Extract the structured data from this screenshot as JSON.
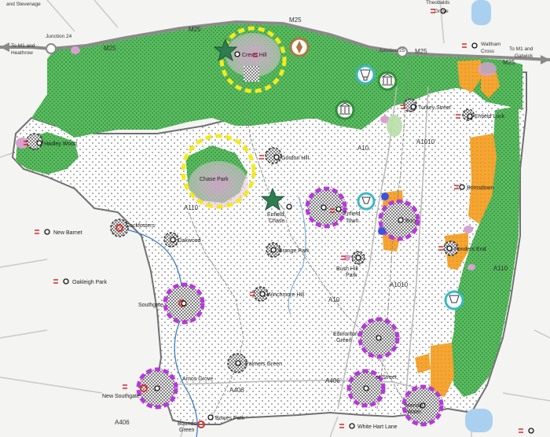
{
  "roads": {
    "m25": "M25",
    "a10": "A10",
    "a1010": "A1010",
    "a406": "A406",
    "a110": "A110"
  },
  "edges": {
    "stevenage": "and Stevenage",
    "junction24": "Junction 24",
    "junction25": "Junction 25",
    "to_m1_heathrow_1": "To M1 and",
    "to_m1_heathrow_2": "Heathrow",
    "to_m1_gatwick_1": "To M1 and",
    "to_m1_gatwick_2": "Gatwick",
    "theobalds_1": "Theobalds",
    "theobalds_2": "Grove",
    "waltham_1": "Waltham",
    "waltham_2": "Cross"
  },
  "stations": {
    "crews_hill": "Crews Hill",
    "hadley_wood": "Hadley Wood",
    "gordon_hill": "Gordon Hill",
    "chase_park": "Chase Park",
    "enfield_chase_1": "Enfield",
    "enfield_chase_2": "Chase",
    "enfield_town_1": "Enfield",
    "enfield_town_2": "Town",
    "turkey_street": "Turkey Street",
    "enfield_lock": "Enfield Lock",
    "brimsdown": "Brimsdown",
    "ponders_end": "Ponders End",
    "enfield_bury": "Bury",
    "cockfosters": "Cockfosters",
    "oakwood": "Oakwood",
    "grange_park": "Grange Park",
    "bush_hill_park_1": "Bush Hill",
    "bush_hill_park_2": "Park",
    "new_barnet": "New Barnet",
    "oakleigh_park": "Oakleigh Park",
    "southgate": "Southgate",
    "winchmore_hill": "Winchmore Hill",
    "edmonton_green_1": "Edmonton",
    "edmonton_green_2": "Green",
    "palmers_green": "Palmers Green",
    "arnos_grove": "Arnos Grove",
    "new_southgate": "New Southgate",
    "silver_street": "er Street",
    "meridian_1": "Meridia",
    "meridian_2": "Water",
    "bowes_park": "Bowes Park",
    "bounds_green_1": "Bounds",
    "bounds_green_2": "Green",
    "white_hart_lane": "White Hart Lane"
  },
  "colors": {
    "green_belt": "#5cbd62",
    "green_dot": "#2f8f3a",
    "industrial": "#f5a531",
    "growth_ring": "#b53ad9",
    "strategic_ring": "#f4ea1e",
    "star": "#2e7d4f",
    "rail": "#d9262b",
    "tube": "#d33030",
    "river": "#3a7fc4",
    "boundary": "#707070"
  }
}
